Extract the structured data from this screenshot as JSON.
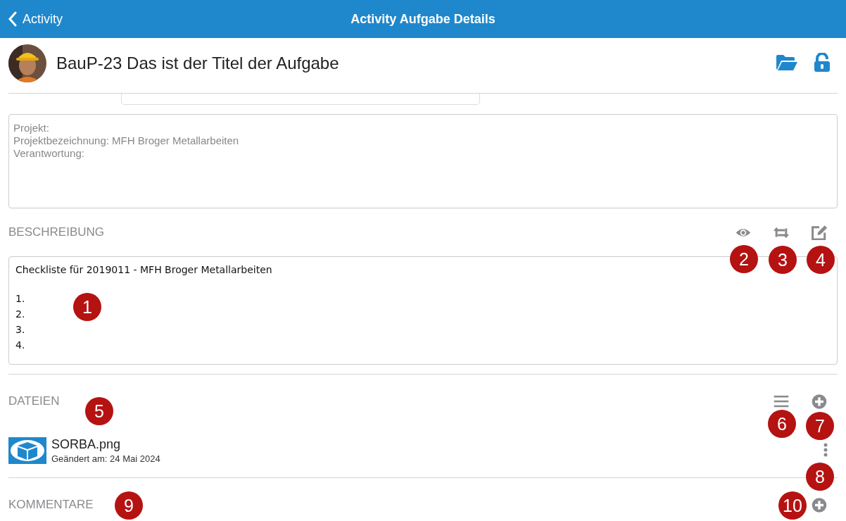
{
  "nav_bar": {
    "back_label": "Activity",
    "title": "Activity Aufgabe Details"
  },
  "task": {
    "title": "BauP-23 Das ist der Titel der Aufgabe"
  },
  "project_info": {
    "lines": [
      "Projekt:",
      "Projektbezeichnung: MFH Broger Metallarbeiten",
      "Verantwortung:"
    ]
  },
  "description": {
    "heading": "BESCHREIBUNG",
    "title": "Checkliste für 2019011 - MFH Broger Metallarbeiten",
    "items": [
      "1.",
      "2.",
      "3.",
      "4."
    ]
  },
  "files": {
    "heading": "DATEIEN",
    "items": [
      {
        "name": "SORBA.png",
        "modified": "Geändert am: 24 Mai 2024"
      }
    ]
  },
  "comments": {
    "heading": "KOMMENTARE"
  },
  "callouts": [
    "1",
    "2",
    "3",
    "4",
    "5",
    "6",
    "7",
    "8",
    "9",
    "10"
  ]
}
